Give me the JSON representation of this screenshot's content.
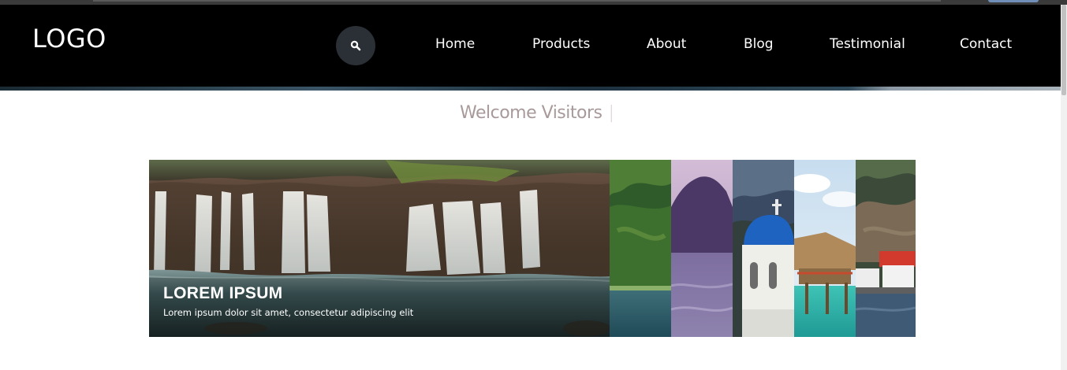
{
  "header": {
    "logo": "LOGO",
    "search_icon": "search-icon",
    "nav": [
      {
        "label": "Home"
      },
      {
        "label": "Products"
      },
      {
        "label": "About"
      },
      {
        "label": "Blog"
      },
      {
        "label": "Testimonial"
      },
      {
        "label": "Contact"
      }
    ]
  },
  "welcome": {
    "text": "Welcome Visitors",
    "cursor": "|"
  },
  "gallery": {
    "active": {
      "title": "LOREM IPSUM",
      "caption": "Lorem ipsum dolor sit amet, consectetur adipiscing elit"
    }
  },
  "colors": {
    "header_bg": "#000000",
    "nav_text": "#ffffff",
    "search_bg": "#2b2f36",
    "welcome_text": "#a89a9a"
  }
}
